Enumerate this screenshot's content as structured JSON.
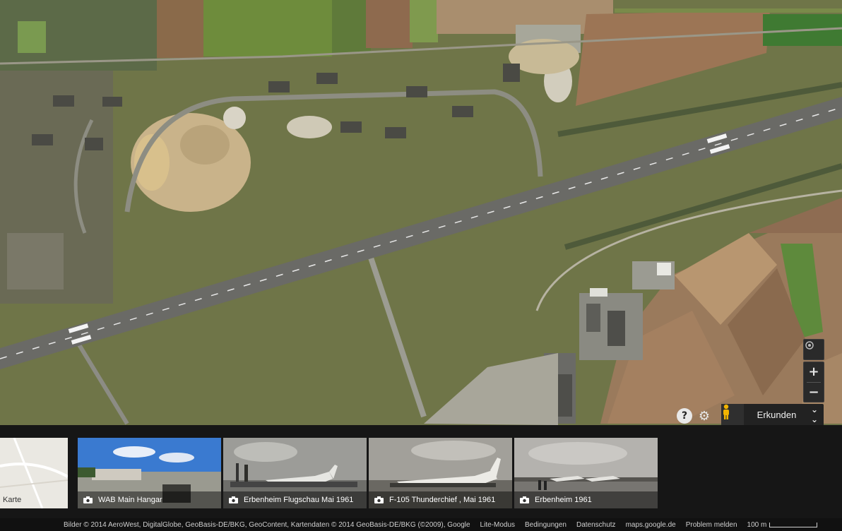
{
  "map": {
    "type": "satellite",
    "location_hint": "airfield",
    "controls": {
      "zoom_in": "+",
      "zoom_out": "−",
      "help": "?",
      "settings_icon": "gear-icon",
      "locate_icon": "my-location-icon"
    },
    "explore": {
      "label": "Erkunden",
      "pegman_icon": "pegman-icon",
      "expand_icon": "double-chevron-down-icon"
    }
  },
  "photo_strip": {
    "items": [
      {
        "caption": "Karte",
        "kind": "map"
      },
      {
        "caption": "WAB Main Hangar",
        "icon": "camera-icon"
      },
      {
        "caption": "Erbenheim Flugschau Mai 1961",
        "icon": "camera-icon"
      },
      {
        "caption": "F-105 Thunderchief , Mai 1961",
        "icon": "camera-icon"
      },
      {
        "caption": "Erbenheim 1961",
        "icon": "camera-icon"
      }
    ]
  },
  "footer": {
    "attribution": "Bilder © 2014 AeroWest, DigitalGlobe, GeoBasis-DE/BKG, GeoContent, Kartendaten © 2014 GeoBasis-DE/BKG (©2009), Google",
    "links": [
      "Lite-Modus",
      "Bedingungen",
      "Datenschutz",
      "maps.google.de",
      "Problem melden"
    ],
    "scale_label": "100 m"
  }
}
